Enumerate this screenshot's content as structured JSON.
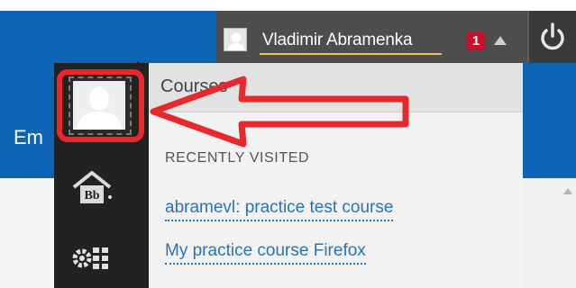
{
  "header": {
    "user_name": "Vladimir Abramenka",
    "notification_count": "1",
    "icons": [
      "avatar",
      "caret-up-icon",
      "power-icon"
    ]
  },
  "page": {
    "partial_label": "Em"
  },
  "dropdown": {
    "title": "Courses",
    "section_label": "RECENTLY VISITED",
    "recent_courses": [
      "abramevl: practice test course",
      "My practice course Firefox"
    ],
    "sidebar_icons": [
      "profile-icon",
      "blackboard-home-icon",
      "tools-icon"
    ]
  },
  "annotation": {
    "highlight_color": "#e8282c",
    "arrow_direction": "left"
  },
  "colors": {
    "brand_blue": "#0d63b4",
    "topbar_dark": "#4d4d4d",
    "badge_red": "#c8102e",
    "link_blue": "#2c73b3"
  }
}
